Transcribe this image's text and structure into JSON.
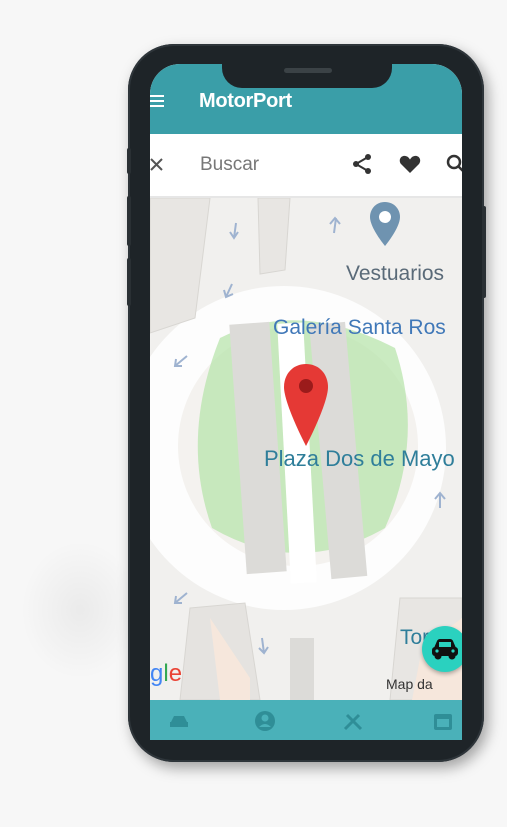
{
  "app": {
    "title": "MotorPort",
    "menu_icon": "hamburger-menu-icon",
    "accent_color": "#3a9ea8"
  },
  "searchbar": {
    "placeholder": "Buscar",
    "close_icon": "close-icon",
    "share_icon": "share-icon",
    "favorite_icon": "heart-icon",
    "search_icon": "search-icon"
  },
  "map": {
    "labels": {
      "vestuarios": "Vestuarios",
      "galeria": "Galería Santa Ros",
      "plaza": "Plaza Dos de Mayo",
      "torre": "Tor"
    },
    "attribution": "Map da",
    "google_logo": "gle",
    "marker_icon": "map-pin-icon",
    "fab_icon": "car-icon",
    "fab_color": "#2ad1bf"
  },
  "bottom_nav": {
    "items": [
      {
        "icon": "car-icon"
      },
      {
        "icon": "user-icon"
      },
      {
        "icon": "tools-icon"
      },
      {
        "icon": "calendar-icon"
      }
    ],
    "color": "#4ab1b9"
  }
}
